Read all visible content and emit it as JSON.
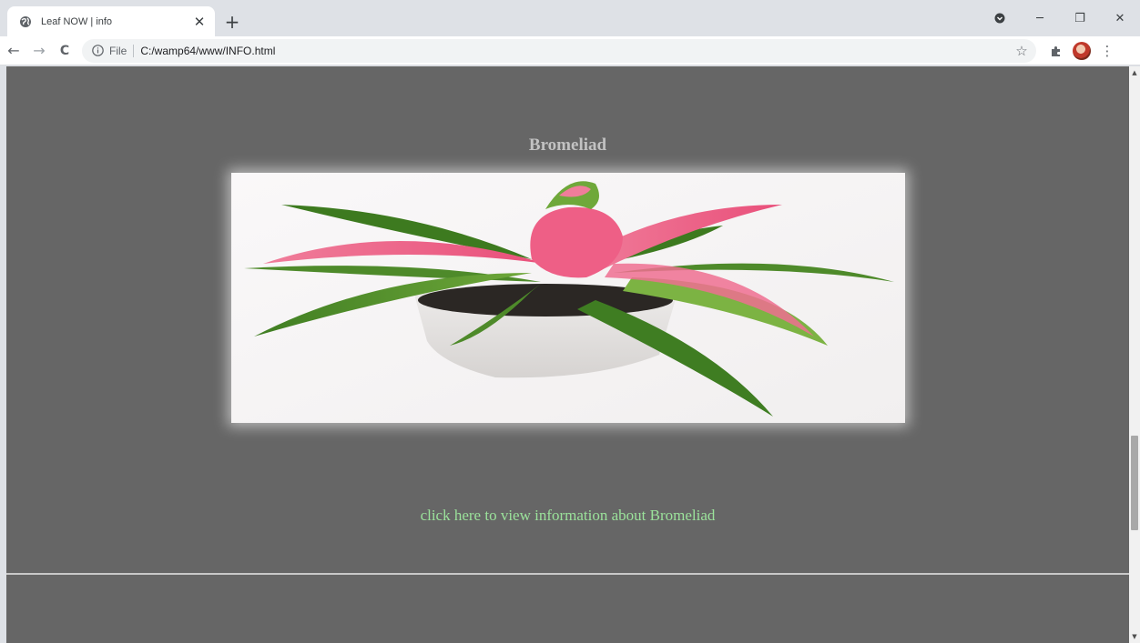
{
  "browser": {
    "tab": {
      "title": "Leaf NOW | info",
      "favicon": "globe-icon",
      "close_glyph": "✕"
    },
    "new_tab_glyph": "+",
    "window_controls": {
      "minimize_glyph": "─",
      "restore_glyph": "❐",
      "close_glyph": "✕"
    },
    "toolbar": {
      "back_glyph": "←",
      "forward_glyph": "→",
      "reload_glyph": "C",
      "scheme_label": "File",
      "url": "C:/wamp64/www/INFO.html",
      "bookmark_glyph": "☆",
      "extensions_icon": "puzzle-icon",
      "menu_glyph": "⋮"
    }
  },
  "page": {
    "heading": "Bromeliad",
    "image_subject": "bromeliad-plant-photo",
    "link_text": "click here to view information about Bromeliad",
    "colors": {
      "background": "#666666",
      "heading": "#c2c2c2",
      "link": "#9be29b",
      "rule": "#c8c8c8"
    }
  },
  "scrollbar": {
    "up_glyph": "▲",
    "down_glyph": "▼"
  }
}
